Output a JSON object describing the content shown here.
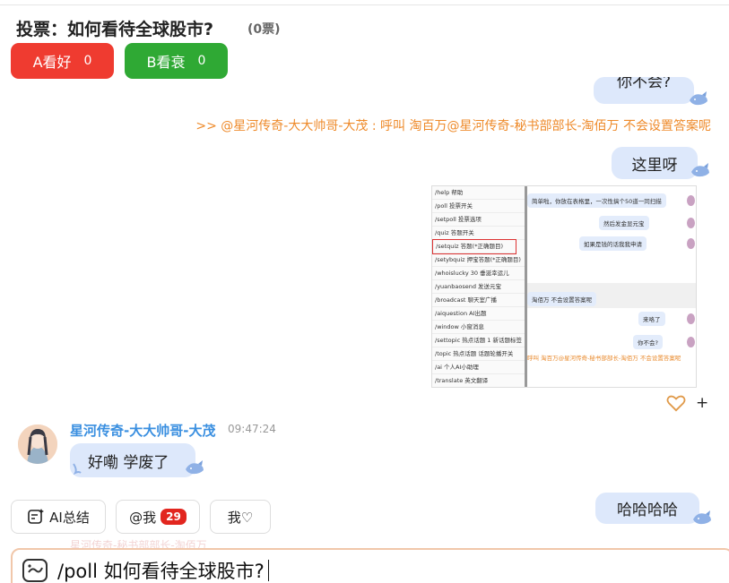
{
  "poll": {
    "title": "投票：如何看待全球股市?",
    "count": "(0票)",
    "option_a": {
      "label": "A看好",
      "count": "0"
    },
    "option_b": {
      "label": "B看衰",
      "count": "0"
    }
  },
  "messages": {
    "partial_bubble": "你不会?",
    "quote": ">> @星河传奇-大大帅哥-大茂 : 呼叫 淘百万@星河传奇-秘书部部长-淘佰万 不会设置答案呢",
    "here": "这里呀",
    "user_name": "星河传奇-大大帅哥-大茂",
    "user_time": "09:47:24",
    "user_msg": "好嘞 学废了",
    "haha": "哈哈哈哈",
    "faded_hint": "星河传奇-秘书部部长-淘佰万"
  },
  "screenshot": {
    "commands": [
      "/help 帮助",
      "/poll 投票开关",
      "/setpoll 投票选项",
      "/quiz 答题开关",
      "/setquiz 答题(*正确题目)",
      "/setybquiz 押宝答题(*正确题目)",
      "/whoislucky 30 垂涎幸运儿",
      "/yuanbaosend 发送元宝",
      "/broadcast 聊天室广播",
      "/aiquestion AI出题",
      "/window 小窗消息",
      "/settopic 热点话题 1 新话题标签",
      "/topic 热点话题 话题轮播开关",
      "/ai 个人AI小助理",
      "/translate 英文翻译"
    ],
    "chat": [
      "简单啦，你放在表格里，一次性搞个50道一同扫描",
      "然后发金显元宝",
      "如果是钱的话我我申请",
      "淘佰万 不会设置答案呢",
      "来咯了",
      "你不会?",
      "呼叫 淘百万@星河传奇-秘书部部长-淘佰万 不会设置答案呢"
    ]
  },
  "actions": {
    "ai_summary": "AI总结",
    "at_me": "@我",
    "at_me_badge": "29",
    "me_like": "我♡"
  },
  "input": {
    "value": "/poll 如何看待全球股市?"
  },
  "colors": {
    "vote_a": "#ef3b30",
    "vote_b": "#2fa934",
    "bubble": "#dde8fb",
    "username": "#3a8fe0",
    "quote": "#ee8a2a",
    "badge": "#e2261f",
    "input_border": "#f1c7aa"
  }
}
